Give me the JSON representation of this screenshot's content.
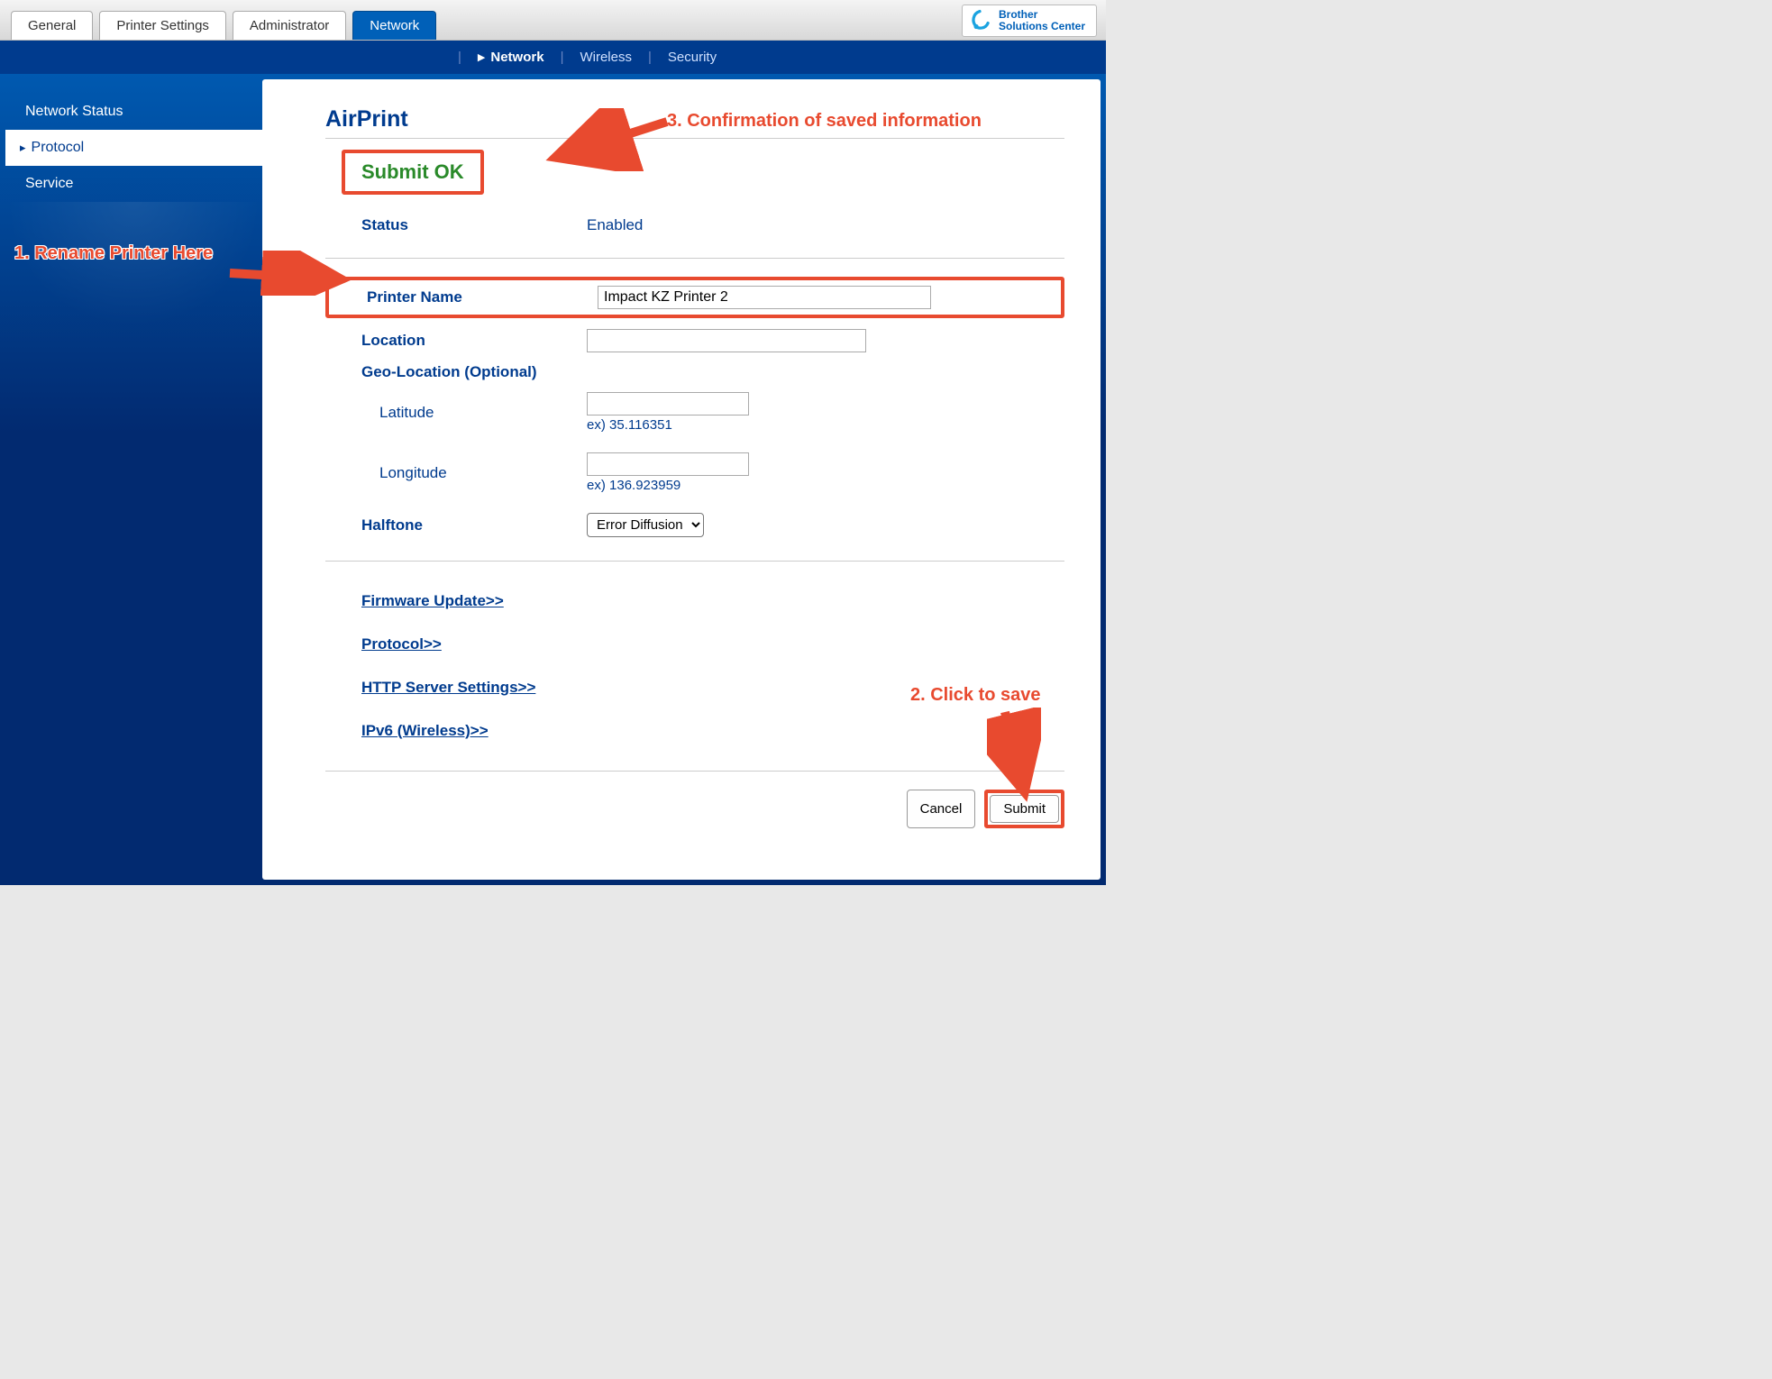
{
  "topTabs": {
    "general": "General",
    "printerSettings": "Printer Settings",
    "administrator": "Administrator",
    "network": "Network"
  },
  "solutionsCenter": {
    "line1": "Brother",
    "line2": "Solutions Center"
  },
  "subnav": {
    "network": "Network",
    "wireless": "Wireless",
    "security": "Security"
  },
  "sidebar": {
    "networkStatus": "Network Status",
    "protocol": "Protocol",
    "service": "Service"
  },
  "page": {
    "title": "AirPrint",
    "submitOk": "Submit OK",
    "statusLabel": "Status",
    "statusValue": "Enabled",
    "printerNameLabel": "Printer Name",
    "printerNameValue": "Impact KZ Printer 2",
    "locationLabel": "Location",
    "locationValue": "",
    "geoLabel": "Geo-Location (Optional)",
    "latLabel": "Latitude",
    "latValue": "",
    "latEx": "ex) 35.116351",
    "lonLabel": "Longitude",
    "lonValue": "",
    "lonEx": "ex) 136.923959",
    "halftoneLabel": "Halftone",
    "halftoneValue": "Error Diffusion",
    "links": {
      "firmware": "Firmware Update>>",
      "protocol": "Protocol>>",
      "http": "HTTP Server Settings>>",
      "ipv6": "IPv6 (Wireless)>>"
    },
    "cancel": "Cancel",
    "submit": "Submit"
  },
  "annotations": {
    "a1": "1. Rename Printer Here",
    "a2": "2. Click to save",
    "a3": "3. Confirmation of saved information"
  }
}
